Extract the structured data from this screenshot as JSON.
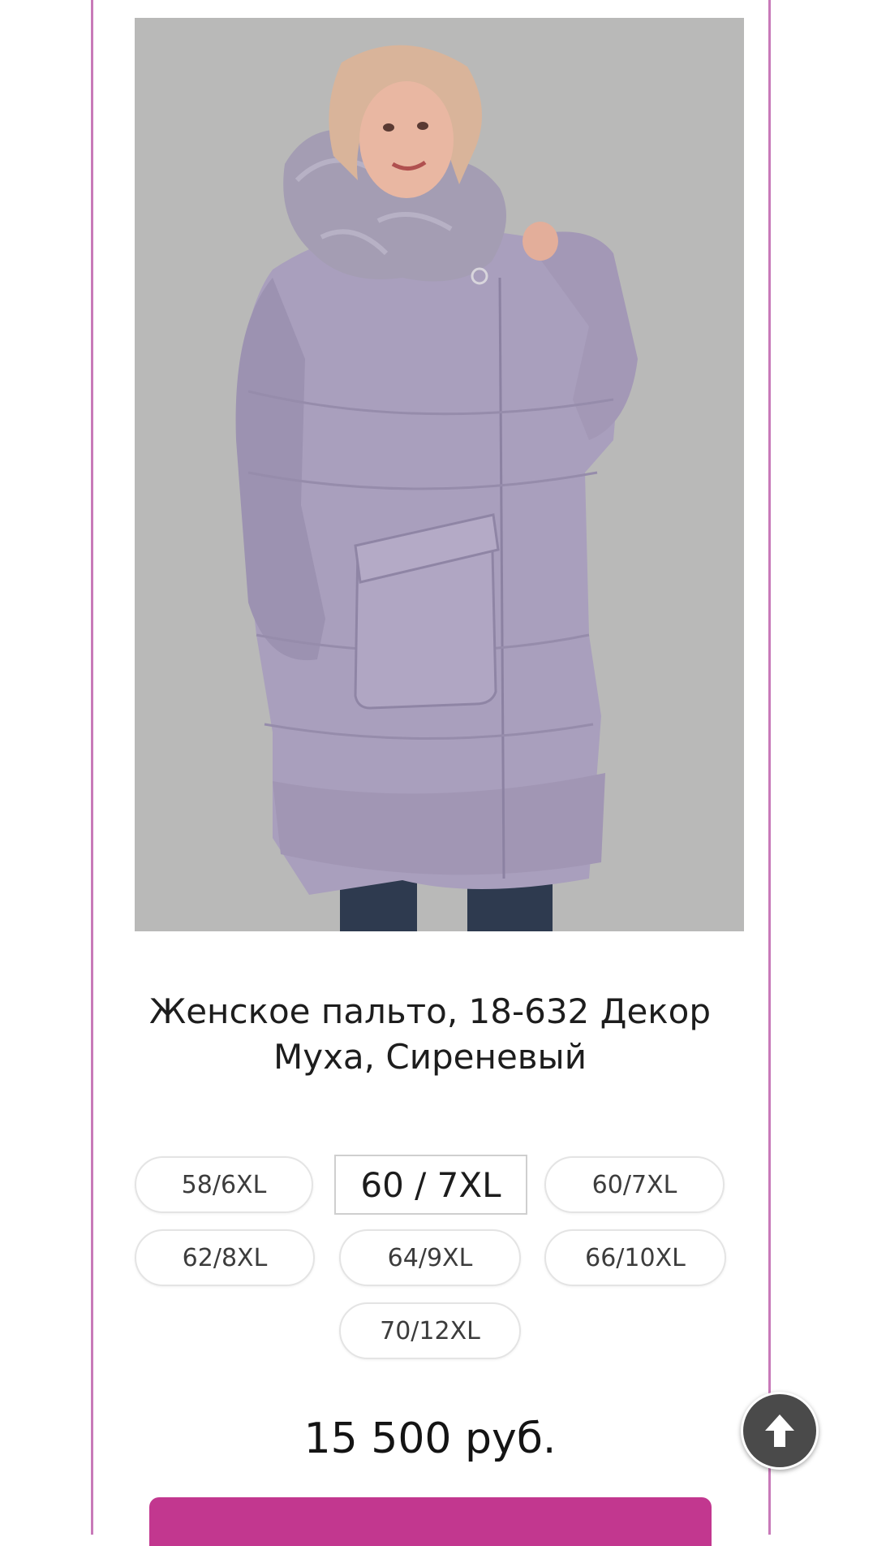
{
  "product": {
    "title_line1": "Женское пальто, 18-632 Декор",
    "title_line2": "Муха, Сиреневый",
    "image_alt": "Женское пальто, 18-632 Декор Муха, Сиреневый",
    "sizes": [
      {
        "label": "58/6XL",
        "selected": false
      },
      {
        "label": "60 / 7XL",
        "selected": true
      },
      {
        "label": "60/7XL",
        "selected": false
      },
      {
        "label": "62/8XL",
        "selected": false
      },
      {
        "label": "64/9XL",
        "selected": false
      },
      {
        "label": "66/10XL",
        "selected": false
      },
      {
        "label": "70/12XL",
        "selected": false
      }
    ],
    "price": "15 500 руб."
  },
  "buy_button": {
    "label": ""
  },
  "icons": {
    "scroll_top": "arrow-up-icon"
  },
  "colors": {
    "frame": "#c87ab9",
    "buy_button": "#c2378f",
    "coat": "#a99fbd",
    "scroll_button": "#4a4a4a"
  }
}
